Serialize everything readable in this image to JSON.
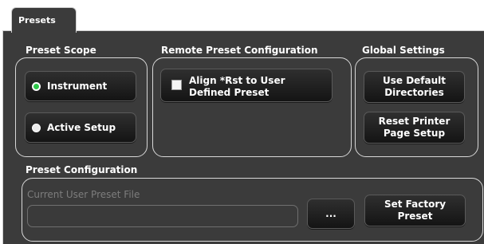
{
  "tab": {
    "label": "Presets"
  },
  "preset_scope": {
    "title": "Preset Scope",
    "options": [
      {
        "label": "Instrument",
        "selected": true
      },
      {
        "label": "Active Setup",
        "selected": false
      }
    ]
  },
  "remote_config": {
    "title": "Remote Preset Configuration",
    "checkbox": {
      "label": "Align *Rst to User Defined Preset",
      "checked": false
    }
  },
  "global_settings": {
    "title": "Global Settings",
    "buttons": [
      {
        "label": "Use Default Directories"
      },
      {
        "label": "Reset Printer Page Setup"
      }
    ]
  },
  "preset_config": {
    "title": "Preset Configuration",
    "file_label": "Current User Preset File",
    "file_value": "",
    "browse_label": "...",
    "factory_label": "Set Factory Preset"
  },
  "colors": {
    "panel_bg": "#3b3b3b",
    "selected_radio": "#2ec74a",
    "border": "#d8d8d8"
  }
}
